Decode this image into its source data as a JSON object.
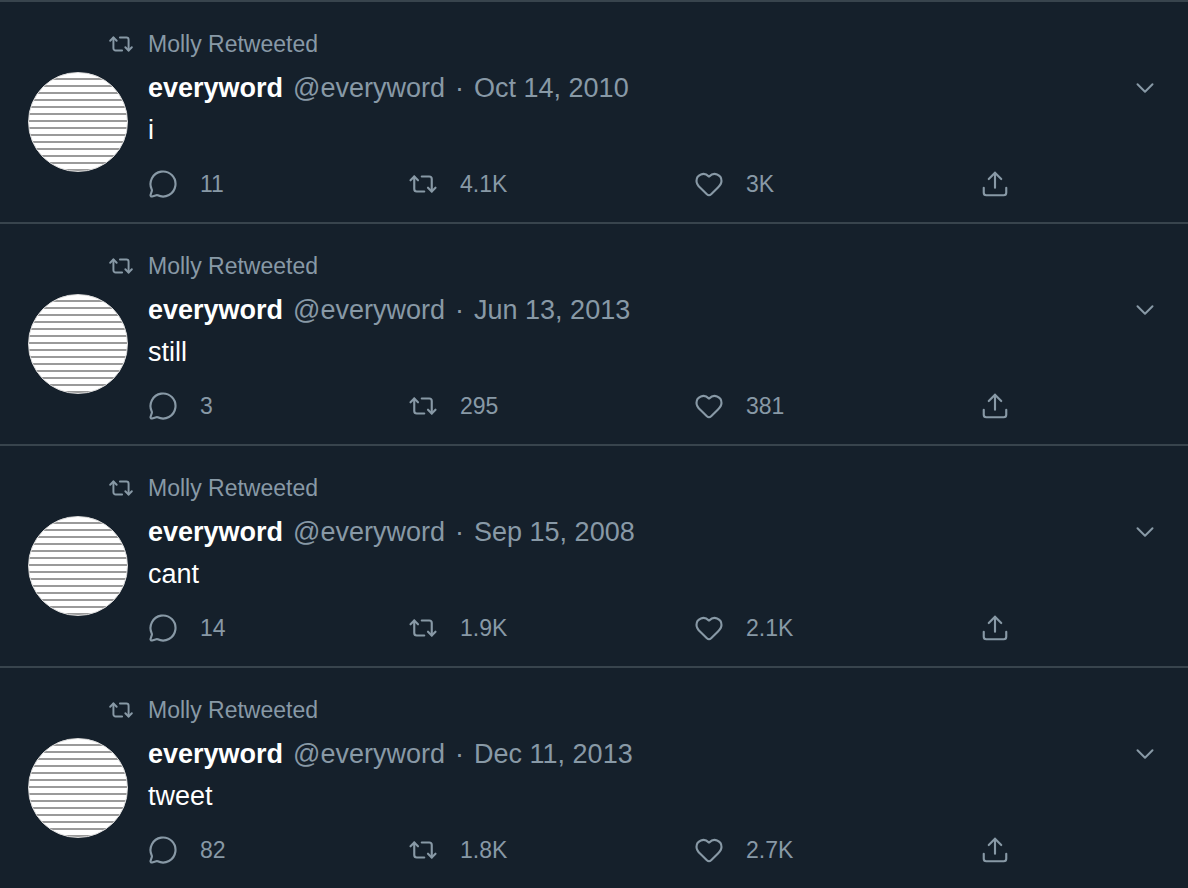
{
  "timeline": {
    "tweets": [
      {
        "retweeter": "Molly Retweeted",
        "name": "everyword",
        "handle": "@everyword",
        "separator": "·",
        "date": "Oct 14, 2010",
        "text": "i",
        "replies": "11",
        "retweets": "4.1K",
        "likes": "3K"
      },
      {
        "retweeter": "Molly Retweeted",
        "name": "everyword",
        "handle": "@everyword",
        "separator": "·",
        "date": "Jun 13, 2013",
        "text": "still",
        "replies": "3",
        "retweets": "295",
        "likes": "381"
      },
      {
        "retweeter": "Molly Retweeted",
        "name": "everyword",
        "handle": "@everyword",
        "separator": "·",
        "date": "Sep 15, 2008",
        "text": "cant",
        "replies": "14",
        "retweets": "1.9K",
        "likes": "2.1K"
      },
      {
        "retweeter": "Molly Retweeted",
        "name": "everyword",
        "handle": "@everyword",
        "separator": "·",
        "date": "Dec 11, 2013",
        "text": "tweet",
        "replies": "82",
        "retweets": "1.8K",
        "likes": "2.7K"
      }
    ]
  }
}
